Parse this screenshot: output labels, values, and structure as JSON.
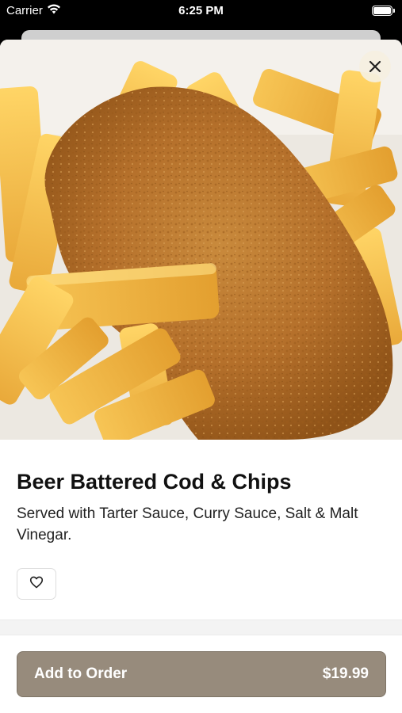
{
  "status_bar": {
    "carrier": "Carrier",
    "time": "6:25 PM",
    "icons": [
      "wifi-icon",
      "battery-icon"
    ]
  },
  "item": {
    "image_description_icon": "food-photo",
    "title": "Beer Battered Cod & Chips",
    "description": "Served with Tarter Sauce, Curry Sauce, Salt & Malt Vinegar."
  },
  "actions": {
    "close_icon": "close-icon",
    "favorite_icon": "heart-icon",
    "add_to_order_label": "Add to Order",
    "price": "$19.99"
  },
  "colors": {
    "button_bg": "#978b7c",
    "close_bg": "#f5f0e1",
    "text_primary": "#111111"
  }
}
